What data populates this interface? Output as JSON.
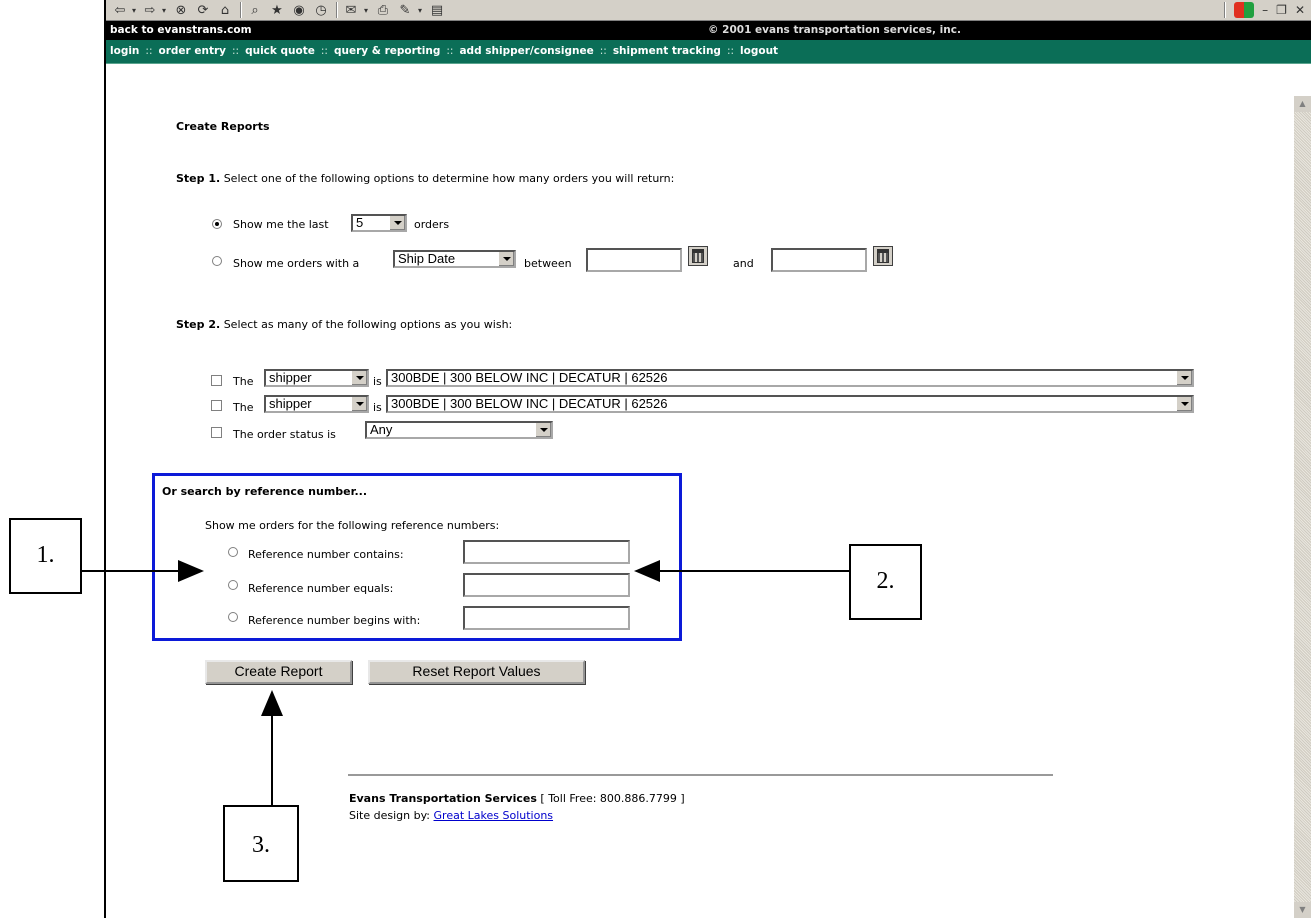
{
  "browser": {
    "toolbar_icons": [
      "back-icon",
      "forward-icon",
      "stop-icon",
      "refresh-icon",
      "home-icon",
      "search-icon",
      "favorites-icon",
      "media-icon",
      "history-icon",
      "mail-icon",
      "print-icon",
      "edit-icon",
      "discuss-icon"
    ],
    "window_controls": [
      "minimize-icon",
      "restore-icon",
      "close-icon"
    ]
  },
  "topbar": {
    "back_link": "back to evanstrans.com",
    "copyright": "© 2001 evans transportation services, inc."
  },
  "nav": {
    "items": [
      "login",
      "order entry",
      "quick quote",
      "query & reporting",
      "add shipper/consignee",
      "shipment tracking",
      "logout"
    ],
    "separator": "::"
  },
  "page": {
    "title": "Create Reports",
    "step1": {
      "heading": "Step 1.",
      "text": "Select one of the following options to determine how many orders you will return:",
      "option1_prefix": "Show me the last",
      "option1_count": "5",
      "option1_suffix": "orders",
      "option2_prefix": "Show me orders with a",
      "option2_field": "Ship Date",
      "option2_between": "between",
      "option2_and": "and",
      "selected_option": 1
    },
    "step2": {
      "heading": "Step 2.",
      "text": "Select as many of the following options as you wish:",
      "filters": [
        {
          "prefix": "The",
          "field": "shipper",
          "is": "is",
          "value": "300BDE | 300 BELOW INC | DECATUR | 62526"
        },
        {
          "prefix": "The",
          "field": "shipper",
          "is": "is",
          "value": "300BDE | 300 BELOW INC | DECATUR | 62526"
        }
      ],
      "status_label": "The order status is",
      "status_value": "Any"
    },
    "reference": {
      "heading": "Or search by reference number...",
      "intro": "Show me orders for the following reference numbers:",
      "options": [
        "Reference number contains:",
        "Reference number equals:",
        "Reference number begins with:"
      ]
    },
    "buttons": {
      "create": "Create Report",
      "reset": "Reset Report Values"
    },
    "footer": {
      "company": "Evans Transportation Services",
      "tollfree": "[ Toll Free: 800.886.7799 ]",
      "credit_prefix": "Site design by:",
      "credit_link": "Great Lakes Solutions"
    }
  },
  "callouts": [
    "1.",
    "2.",
    "3."
  ],
  "colors": {
    "nav_bg": "#0b6e57",
    "topbar_bg": "#000000",
    "highlight_box": "#0c1ad8",
    "link": "#0000cc"
  }
}
